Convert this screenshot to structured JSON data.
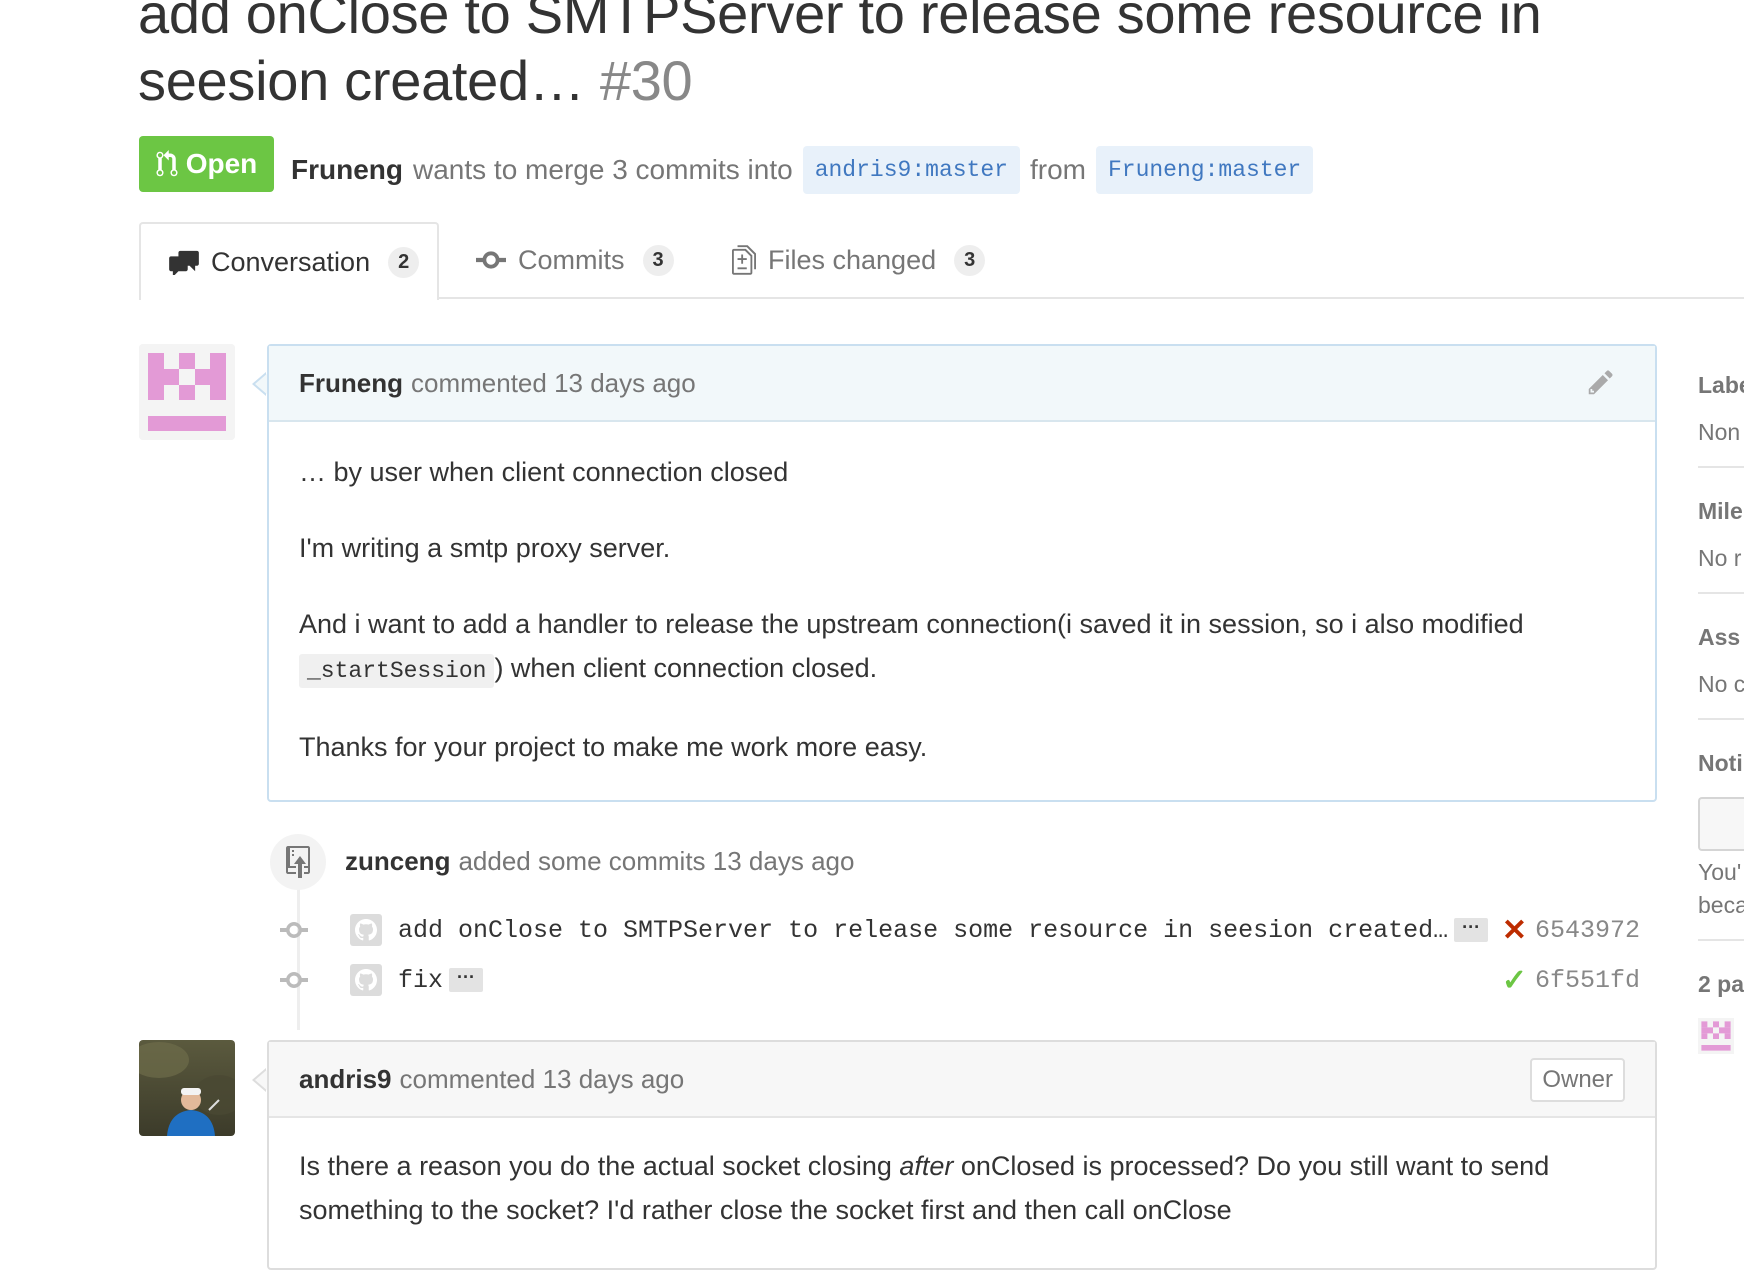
{
  "pr": {
    "title": "add onClose to SMTPServer to release some resource in seesion created…",
    "number": "#30",
    "state": "Open",
    "author": "Fruneng",
    "merge_text": "wants to merge 3 commits into",
    "base_repo": "andris9",
    "base_branch": "master",
    "from_text": "from",
    "head_repo": "Fruneng",
    "head_branch": "master"
  },
  "tabs": [
    {
      "label": "Conversation",
      "count": "2",
      "icon": "comment-discussion-icon"
    },
    {
      "label": "Commits",
      "count": "3",
      "icon": "git-commit-icon"
    },
    {
      "label": "Files changed",
      "count": "3",
      "icon": "file-diff-icon"
    }
  ],
  "comments": [
    {
      "author": "Fruneng",
      "meta": "commented 13 days ago",
      "paragraphs": [
        "… by user when client connection closed",
        "I'm writing a smtp proxy server.",
        "And i want to add a handler to release the upstream connection(i saved it in session, so i also modified",
        "_startSession",
        ") when client connection closed.",
        "Thanks for your project to make me work more easy."
      ]
    },
    {
      "author": "andris9",
      "meta": "commented 13 days ago",
      "badge": "Owner",
      "text_before": "Is there a reason you do the actual socket closing ",
      "text_em": "after",
      "text_after": " onClosed is processed? Do you still want to send",
      "text_line2": "something to the socket? I'd rather close the socket first and then call onClose"
    }
  ],
  "event": {
    "author": "zunceng",
    "text": "added some commits 13 days ago",
    "icon": "repo-push-icon"
  },
  "commits": [
    {
      "message": "add onClose to SMTPServer to release some resource in seesion created…",
      "expander": "···",
      "status": "✕",
      "status_color": "#bd2c00",
      "sha": "6543972"
    },
    {
      "message": "fix",
      "expander": "···",
      "status": "✓",
      "status_color": "#6cc644",
      "sha": "6f551fd"
    }
  ],
  "sidebar": {
    "labels_head": "Labe",
    "labels_val": "Non",
    "milestone_head": "Mile",
    "milestone_val": "No r",
    "assignee_head": "Ass",
    "assignee_val": "No c",
    "notifications_head": "Noti",
    "notif_line1": "You'",
    "notif_line2": "beca",
    "participants_head": "2 pa"
  },
  "colors": {
    "open_green": "#6cc644",
    "link_blue": "#4078c0",
    "identicon_pink": "#e39ad6"
  }
}
